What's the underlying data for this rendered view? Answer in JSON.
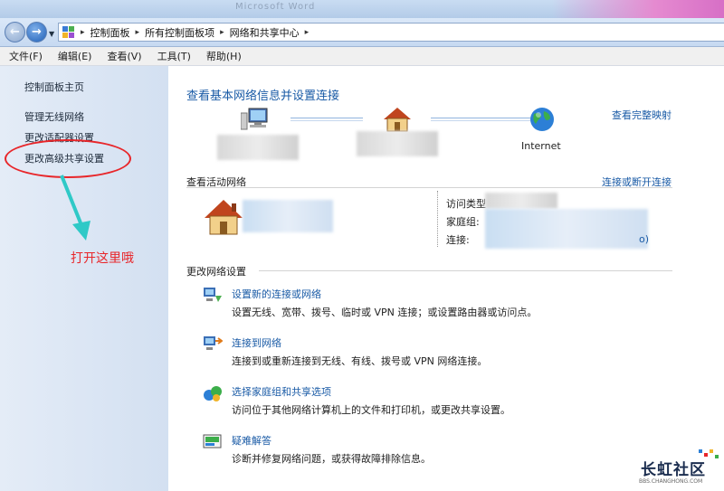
{
  "title_bar": {
    "ghost_text": "Microsoft Word"
  },
  "address": {
    "crumbs": [
      "控制面板",
      "所有控制面板项",
      "网络和共享中心"
    ],
    "separator": "▸"
  },
  "menu": [
    "文件(F)",
    "编辑(E)",
    "查看(V)",
    "工具(T)",
    "帮助(H)"
  ],
  "sidebar": {
    "home": "控制面板主页",
    "links": [
      "管理无线网络",
      "更改适配器设置",
      "更改高级共享设置"
    ]
  },
  "annotation": {
    "text": "打开这里哦",
    "color": "#e8262a"
  },
  "main": {
    "title": "查看基本网络信息并设置连接",
    "full_map_link": "查看完整映射",
    "internet_label": "Internet",
    "active_networks_title": "查看活动网络",
    "connect_disconnect_link": "连接或断开连接",
    "details": [
      "访问类型",
      "家庭组:",
      "连接:"
    ],
    "details_tail": "o)",
    "change_settings_title": "更改网络设置",
    "tasks": [
      {
        "icon": "network-setup-icon",
        "link": "设置新的连接或网络",
        "desc": "设置无线、宽带、拨号、临时或 VPN 连接；或设置路由器或访问点。"
      },
      {
        "icon": "connect-network-icon",
        "link": "连接到网络",
        "desc": "连接到或重新连接到无线、有线、拨号或 VPN 网络连接。"
      },
      {
        "icon": "homegroup-icon",
        "link": "选择家庭组和共享选项",
        "desc": "访问位于其他网络计算机上的文件和打印机，或更改共享设置。"
      },
      {
        "icon": "troubleshoot-icon",
        "link": "疑难解答",
        "desc": "诊断并修复网络问题，或获得故障排除信息。"
      }
    ]
  },
  "watermark": {
    "text": "长虹社区",
    "sub": "BBS.CHANGHONG.COM"
  },
  "colors": {
    "link": "#1a5ba6",
    "accent_red": "#e8262a",
    "sidebar_bg": "#d3e0f1"
  }
}
